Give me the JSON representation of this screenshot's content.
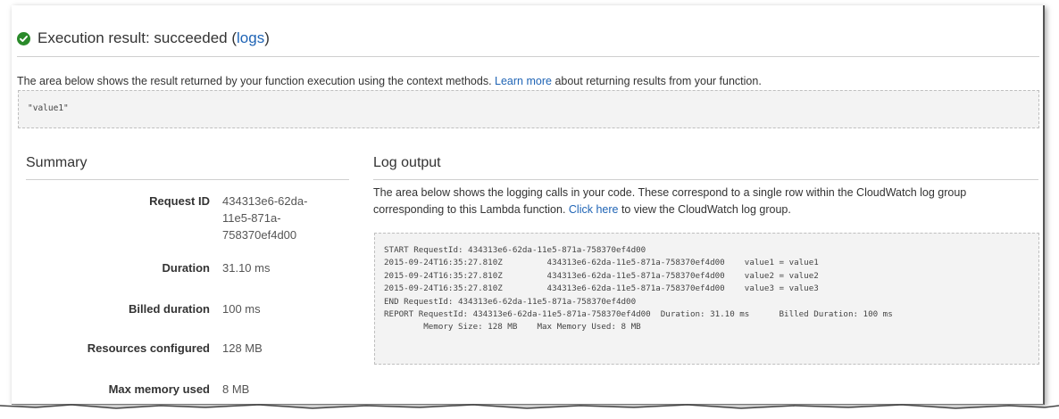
{
  "header": {
    "title_prefix": "Execution result: succeeded (",
    "title_link": "logs",
    "title_suffix": ")",
    "status_icon": "check-circle-icon",
    "status_color": "#2a8a2a"
  },
  "description": {
    "text_before": "The area below shows the result returned by your function execution using the context methods. ",
    "link": "Learn more",
    "text_after": " about returning results from your function."
  },
  "result_value": "\"value1\"",
  "summary": {
    "title": "Summary",
    "rows": [
      {
        "label": "Request ID",
        "value_lines": [
          "434313e6-62da-",
          "11e5-871a-",
          "758370ef4d00"
        ]
      },
      {
        "label": "Duration",
        "value": "31.10 ms"
      },
      {
        "label": "Billed duration",
        "value": "100 ms"
      },
      {
        "label": "Resources configured",
        "value": "128 MB"
      },
      {
        "label": "Max memory used",
        "value": "8 MB"
      }
    ]
  },
  "log_output": {
    "title": "Log output",
    "desc_before": "The area below shows the logging calls in your code. These correspond to a single row within the CloudWatch log group corresponding to this Lambda function. ",
    "desc_link": "Click here",
    "desc_after": " to view the CloudWatch log group.",
    "lines": [
      "START RequestId: 434313e6-62da-11e5-871a-758370ef4d00",
      "2015-09-24T16:35:27.810Z         434313e6-62da-11e5-871a-758370ef4d00    value1 = value1",
      "2015-09-24T16:35:27.810Z         434313e6-62da-11e5-871a-758370ef4d00    value2 = value2",
      "2015-09-24T16:35:27.810Z         434313e6-62da-11e5-871a-758370ef4d00    value3 = value3",
      "END RequestId: 434313e6-62da-11e5-871a-758370ef4d00",
      "REPORT RequestId: 434313e6-62da-11e5-871a-758370ef4d00  Duration: 31.10 ms      Billed Duration: 100 ms",
      "        Memory Size: 128 MB    Max Memory Used: 8 MB"
    ]
  },
  "colors": {
    "link": "#1f64b5",
    "box_bg": "#f3f3f3",
    "rule": "#cfcfcf"
  }
}
